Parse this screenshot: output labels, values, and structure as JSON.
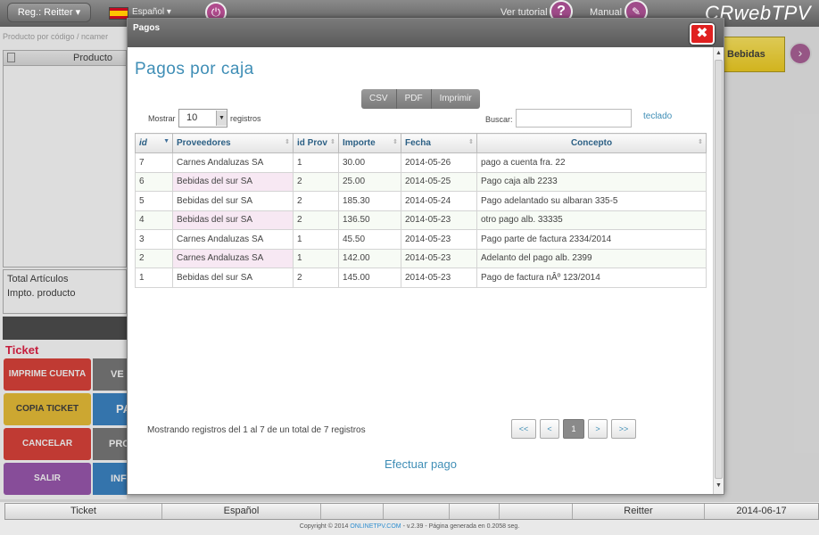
{
  "topbar": {
    "reg_label": "Reg.: Reitter ▾",
    "lang_label": "Español ▾",
    "tutorial_label": "Ver tutorial",
    "manual_label": "Manual",
    "brand": "CRwebTPV"
  },
  "left": {
    "search_placeholder": "Producto por código / ncamer",
    "product_header": "Producto",
    "total_articulos": "Total Artículos",
    "impto_producto": "Impto. producto",
    "ticket_title": "Ticket",
    "buttons": [
      {
        "label": "IMPRIME CUENTA",
        "color": "#d9261c"
      },
      {
        "label": "COPIA TICKET",
        "color": "#e9b71a"
      },
      {
        "label": "CANCELAR",
        "color": "#d9261c"
      },
      {
        "label": "SALIR",
        "color": "#8d3fa5"
      }
    ],
    "right_buttons": [
      "VE",
      "PA",
      "PRO",
      "INF"
    ]
  },
  "category": {
    "label": "Bebidas",
    "color": "#f5d000"
  },
  "statusbar": [
    "Ticket",
    "Español",
    "",
    "",
    "",
    "",
    "Reitter",
    "2014-06-17"
  ],
  "copyright": {
    "prefix": "Copyright © 2014 ",
    "link": "ONLINETPV.COM",
    "suffix": " - v.2.39 - Página generada en 0.2058 seg."
  },
  "modal": {
    "title": "Pagos",
    "close_label": "✖",
    "heading": "Pagos por caja",
    "export_buttons": [
      "CSV",
      "PDF",
      "Imprimir"
    ],
    "show_label": "Mostrar",
    "page_length": "10",
    "records_label": "registros",
    "search_label": "Buscar:",
    "search_value": "",
    "keyboard_link": "teclado",
    "columns": [
      "id",
      "Proveedores",
      "id Prov",
      "Importe",
      "Fecha",
      "Concepto"
    ],
    "rows": [
      {
        "id": "7",
        "proveedor": "Carnes Andaluzas SA",
        "id_prov": "1",
        "importe": "30.00",
        "fecha": "2014-05-26",
        "concepto": "pago a cuenta fra. 22"
      },
      {
        "id": "6",
        "proveedor": "Bebidas del sur SA",
        "id_prov": "2",
        "importe": "25.00",
        "fecha": "2014-05-25",
        "concepto": "Pago caja alb 2233"
      },
      {
        "id": "5",
        "proveedor": "Bebidas del sur SA",
        "id_prov": "2",
        "importe": "185.30",
        "fecha": "2014-05-24",
        "concepto": "Pago adelantado su albaran 335-5"
      },
      {
        "id": "4",
        "proveedor": "Bebidas del sur SA",
        "id_prov": "2",
        "importe": "136.50",
        "fecha": "2014-05-23",
        "concepto": "otro pago alb. 33335"
      },
      {
        "id": "3",
        "proveedor": "Carnes Andaluzas SA",
        "id_prov": "1",
        "importe": "45.50",
        "fecha": "2014-05-23",
        "concepto": "Pago parte de factura 2334/2014"
      },
      {
        "id": "2",
        "proveedor": "Carnes Andaluzas SA",
        "id_prov": "1",
        "importe": "142.00",
        "fecha": "2014-05-23",
        "concepto": "Adelanto del pago alb. 2399"
      },
      {
        "id": "1",
        "proveedor": "Bebidas del sur SA",
        "id_prov": "2",
        "importe": "145.00",
        "fecha": "2014-05-23",
        "concepto": "Pago de factura nÂº 123/2014"
      }
    ],
    "info": "Mostrando registros del 1 al 7 de un total de 7 registros",
    "pager": {
      "first": "<<",
      "prev": "<",
      "current": "1",
      "next": ">",
      "last": ">>"
    },
    "action_link": "Efectuar pago"
  }
}
